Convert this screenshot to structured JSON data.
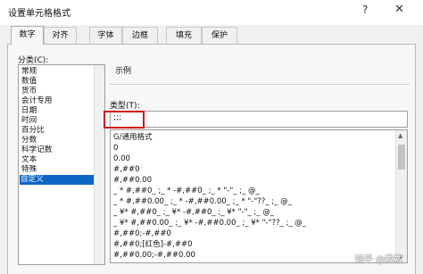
{
  "window": {
    "title": "设置单元格格式",
    "help": "?",
    "close": "✕"
  },
  "tabs": [
    "数字",
    "对齐",
    "字体",
    "边框",
    "填充",
    "保护"
  ],
  "category": {
    "label": "分类(C):",
    "items": [
      "常规",
      "数值",
      "货币",
      "会计专用",
      "日期",
      "时间",
      "百分比",
      "分数",
      "科学记数",
      "文本",
      "特殊",
      "自定义"
    ],
    "selected": "自定义"
  },
  "sample": {
    "label": "示例"
  },
  "type": {
    "label": "类型(T):",
    "value": ";;;",
    "highlight_color": "#d31a1a",
    "formats": [
      "G/通用格式",
      "0",
      "0.00",
      "#,##0",
      "#,##0.00",
      "_ * #,##0_ ;_ * -#,##0_ ;_ * \"-\"_ ;_ @_",
      "_ * #,##0.00_ ;_ * -#,##0.00_ ;_ * \"-\"??_ ;_ @_",
      "_ ¥* #,##0_ ;_ ¥* -#,##0_ ;_ ¥* \"-\"_ ;_ @_",
      "_ ¥* #,##0.00_ ;_ ¥* -#,##0.00_ ;_ ¥* \"-\"??_ ;_ @_",
      "#,##0;-#,##0",
      "#,##0;[红色]-#,##0",
      "#,##0.00;-#,##0.00"
    ]
  },
  "watermark": "知乎 @戴戴",
  "colors": {
    "accent": "#0b66c4"
  }
}
